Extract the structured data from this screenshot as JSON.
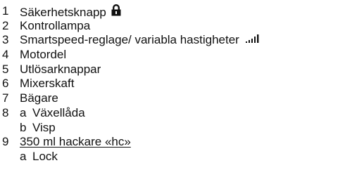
{
  "items": [
    {
      "num": "1",
      "letter": "",
      "label": "Säkerhetsknapp",
      "icon": "lock-icon"
    },
    {
      "num": "2",
      "letter": "",
      "label": "Kontrollampa"
    },
    {
      "num": "3",
      "letter": "",
      "label": "Smartspeed-reglage/ variabla hastigheter",
      "icon": "speed-bars-icon"
    },
    {
      "num": "4",
      "letter": "",
      "label": "Motordel"
    },
    {
      "num": "5",
      "letter": "",
      "label": "Utlösarknappar"
    },
    {
      "num": "6",
      "letter": "",
      "label": "Mixerskaft"
    },
    {
      "num": "7",
      "letter": "",
      "label": "Bägare"
    },
    {
      "num": "8",
      "letter": "a",
      "label": "Växellåda"
    },
    {
      "num": "",
      "letter": "b",
      "label": "Visp"
    },
    {
      "num": "9",
      "letter": "",
      "label": "350 ml hackare «hc»",
      "underlined": true
    },
    {
      "num": "",
      "letter": "a",
      "label": "Lock"
    }
  ]
}
